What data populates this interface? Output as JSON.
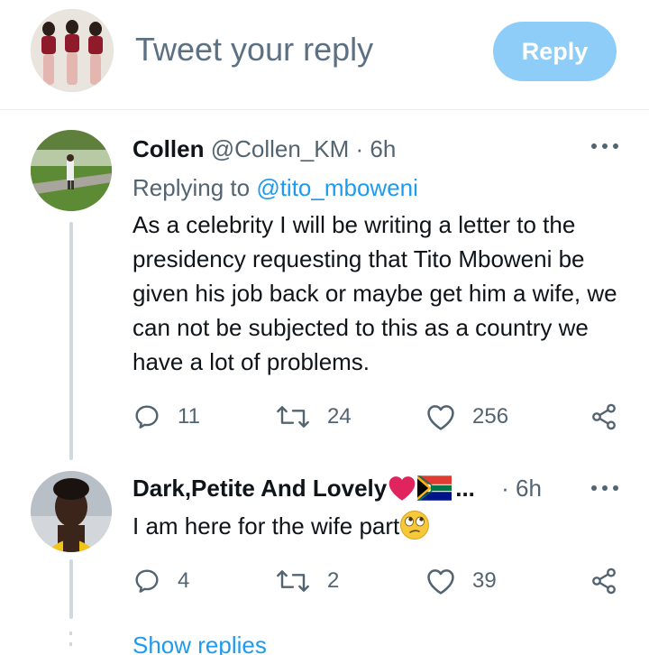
{
  "compose": {
    "placeholder": "Tweet your reply",
    "reply_label": "Reply"
  },
  "tweets": [
    {
      "name": "Collen",
      "handle": "@Collen_KM",
      "separator": "·",
      "time": "6h",
      "replying_prefix": "Replying to ",
      "replying_to": "@tito_mboweni",
      "text": "As a celebrity I will be writing a letter to the presidency requesting that Tito Mboweni be given his job back or maybe get him a wife, we can not be subjected to this as a country we have a lot of problems.",
      "replies": "11",
      "retweets": "24",
      "likes": "256"
    },
    {
      "name": "Dark,Petite And Lovely",
      "name_emoji_suffix": "...",
      "separator": "·",
      "time": "6h",
      "text": "I am here for the wife part",
      "replies": "4",
      "retweets": "2",
      "likes": "39"
    }
  ],
  "show_replies": "Show replies",
  "colors": {
    "link": "#1d9bf0",
    "reply_button": "#8ecdf7",
    "secondary_text": "#536471",
    "heart": "#e0245e"
  },
  "icons": [
    "reply-icon",
    "retweet-icon",
    "like-icon",
    "share-icon",
    "more-icon",
    "heart-emoji",
    "flag-emoji",
    "rolling-eyes-emoji"
  ]
}
